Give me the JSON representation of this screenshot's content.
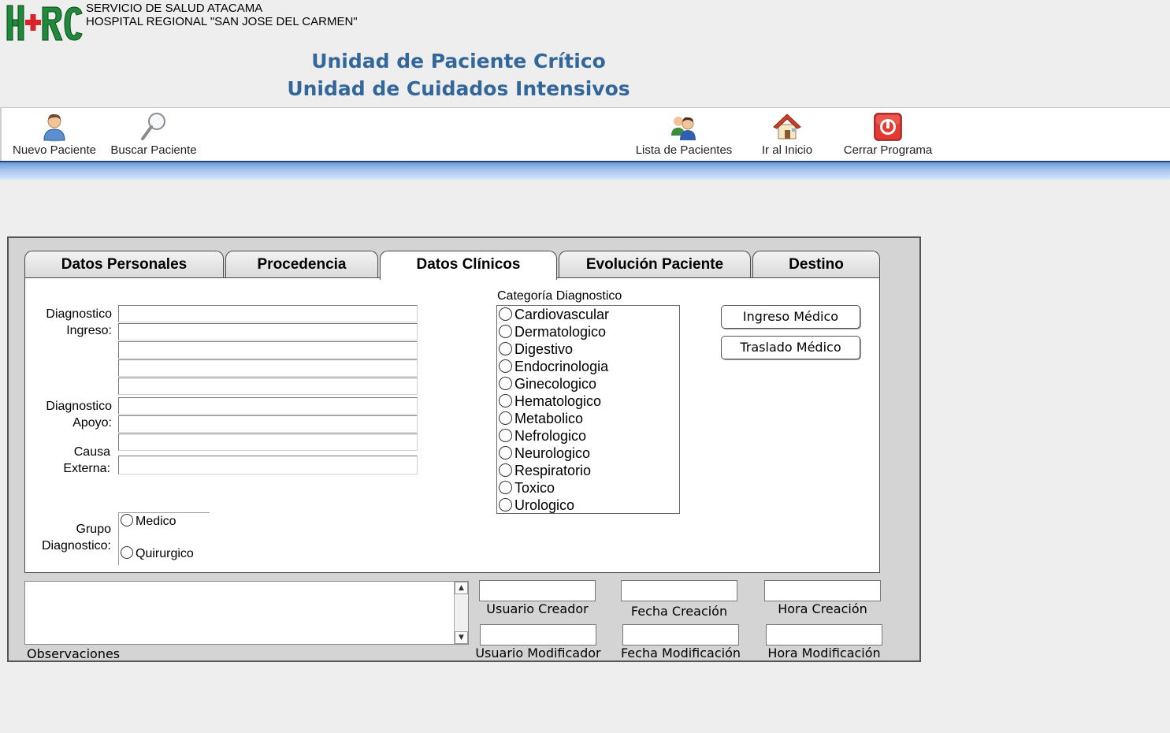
{
  "header": {
    "logo_text": "H+RC",
    "org_line1": "SERVICIO DE SALUD ATACAMA",
    "org_line2": "HOSPITAL REGIONAL \"SAN JOSE DEL CARMEN\"",
    "title1": "Unidad de Paciente Crítico",
    "title2": "Unidad de Cuidados Intensivos"
  },
  "toolbar": {
    "items": [
      {
        "label": "Nuevo Paciente",
        "icon": "user-icon"
      },
      {
        "label": "Buscar Paciente",
        "icon": "magnifier-icon"
      },
      {
        "label": "Lista de Pacientes",
        "icon": "users-group-icon"
      },
      {
        "label": "Ir al Inicio",
        "icon": "home-icon"
      },
      {
        "label": "Cerrar Programa",
        "icon": "power-icon"
      }
    ]
  },
  "tabs": [
    {
      "label": "Datos Personales",
      "active": false
    },
    {
      "label": "Procedencia",
      "active": false
    },
    {
      "label": "Datos Clínicos",
      "active": true
    },
    {
      "label": "Evolución Paciente",
      "active": false
    },
    {
      "label": "Destino",
      "active": false
    }
  ],
  "clinical": {
    "diag_ingreso_label": "Diagnostico\nIngreso:",
    "diag_apoyo_label": "Diagnostico\nApoyo:",
    "causa_externa_label": "Causa\nExterna:",
    "grupo_label": "Grupo\nDiagnostico:",
    "grupo_options": [
      "Medico",
      "Quirurgico"
    ],
    "categoria_label": "Categoría Diagnostico",
    "categorias": [
      "Cardiovascular",
      "Dermatologico",
      "Digestivo",
      "Endocrinologia",
      "Ginecologico",
      "Hematologico",
      "Metabolico",
      "Nefrologico",
      "Neurologico",
      "Respiratorio",
      "Toxico",
      "Urologico"
    ],
    "btn_ingreso": "Ingreso Médico",
    "btn_traslado": "Traslado Médico"
  },
  "bottom": {
    "observaciones_label": "Observaciones",
    "usuario_creador": "Usuario Creador",
    "fecha_creacion": "Fecha Creación",
    "hora_creacion": "Hora Creación",
    "usuario_modificador": "Usuario Modificador",
    "fecha_modificacion": "Fecha Modificación",
    "hora_modificacion": "Hora Modificación"
  },
  "colors": {
    "title_blue": "#336699",
    "logo_green": "#2e8b3a",
    "logo_red": "#d8232a",
    "band_blue": "#6d99d6"
  }
}
